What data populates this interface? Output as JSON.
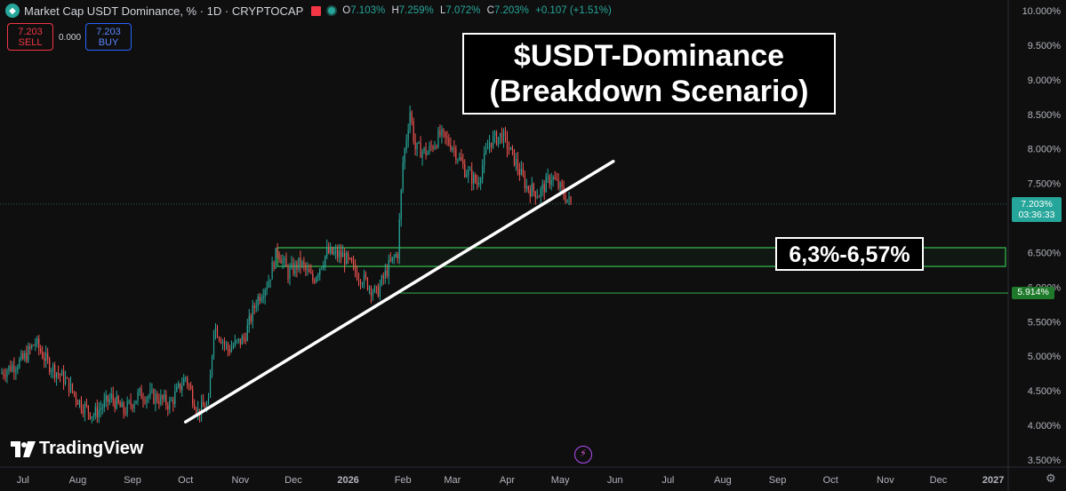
{
  "header": {
    "title": "Market Cap USDT Dominance, % · 1D · CRYPTOCAP",
    "ohlc": [
      {
        "k": "O",
        "v": "7.103%"
      },
      {
        "k": "H",
        "v": "7.259%"
      },
      {
        "k": "L",
        "v": "7.072%"
      },
      {
        "k": "C",
        "v": "7.203%"
      }
    ],
    "change": "+0.107 (+1.51%)"
  },
  "trade": {
    "sell_price": "7.203",
    "sell_label": "SELL",
    "spread": "0.000",
    "buy_price": "7.203",
    "buy_label": "BUY"
  },
  "annotations": {
    "title_line1": "$USDT-Dominance",
    "title_line2": "(Breakdown Scenario)",
    "zone_label": "6,3%-6,57%"
  },
  "price_scale": {
    "current_price": "7.203%",
    "countdown": "03:36:33",
    "level_tag": "5.914%"
  },
  "brand": {
    "logo_text": "TradingView"
  },
  "colors": {
    "up": "#26a69a",
    "down": "#ef5350",
    "zone": "#2f9e44",
    "trendline": "#ffffff"
  },
  "chart_data": {
    "type": "candlestick",
    "y_ticks": [
      "10.000%",
      "9.500%",
      "9.000%",
      "8.500%",
      "8.000%",
      "7.500%",
      "7.000%",
      "6.500%",
      "6.000%",
      "5.500%",
      "5.000%",
      "4.500%",
      "4.000%",
      "3.500%"
    ],
    "y_tick_values": [
      10.0,
      9.5,
      9.0,
      8.5,
      8.0,
      7.5,
      7.0,
      6.5,
      6.0,
      5.5,
      5.0,
      4.5,
      4.0,
      3.5
    ],
    "ylim": [
      3.5,
      10.0
    ],
    "x_ticks": [
      "Jul",
      "Aug",
      "Sep",
      "Oct",
      "Nov",
      "Dec",
      "2026",
      "Feb",
      "Mar",
      "Apr",
      "May",
      "Jun",
      "Jul",
      "Aug",
      "Sep",
      "Oct",
      "Nov",
      "Dec",
      "2027"
    ],
    "x_tick_dates": [
      "2025-07-01",
      "2025-08-01",
      "2025-09-01",
      "2025-10-01",
      "2025-11-01",
      "2025-12-01",
      "2026-01-01",
      "2026-02-01",
      "2026-03-01",
      "2026-04-01",
      "2026-05-01",
      "2026-06-01",
      "2026-07-01",
      "2026-08-01",
      "2026-09-01",
      "2026-10-01",
      "2026-11-01",
      "2026-12-01",
      "2027-01-01"
    ],
    "x_range": [
      "2025-06-18",
      "2027-01-08"
    ],
    "price_path": [
      [
        "2025-06-18",
        4.75
      ],
      [
        "2025-07-01",
        4.95
      ],
      [
        "2025-07-08",
        5.2
      ],
      [
        "2025-07-15",
        4.9
      ],
      [
        "2025-07-25",
        4.65
      ],
      [
        "2025-08-03",
        4.3
      ],
      [
        "2025-08-10",
        4.15
      ],
      [
        "2025-08-20",
        4.4
      ],
      [
        "2025-08-27",
        4.2
      ],
      [
        "2025-09-05",
        4.45
      ],
      [
        "2025-09-15",
        4.4
      ],
      [
        "2025-09-22",
        4.3
      ],
      [
        "2025-10-01",
        4.7
      ],
      [
        "2025-10-08",
        4.2
      ],
      [
        "2025-10-14",
        4.3
      ],
      [
        "2025-10-17",
        5.45
      ],
      [
        "2025-10-25",
        5.1
      ],
      [
        "2025-11-03",
        5.25
      ],
      [
        "2025-11-10",
        5.8
      ],
      [
        "2025-11-17",
        6.1
      ],
      [
        "2025-11-22",
        6.55
      ],
      [
        "2025-11-28",
        6.2
      ],
      [
        "2025-12-05",
        6.35
      ],
      [
        "2025-12-12",
        6.1
      ],
      [
        "2025-12-20",
        6.5
      ],
      [
        "2025-12-29",
        6.45
      ],
      [
        "2026-01-06",
        6.2
      ],
      [
        "2026-01-12",
        6.05
      ],
      [
        "2026-01-17",
        5.9
      ],
      [
        "2026-01-24",
        6.3
      ],
      [
        "2026-01-29",
        6.5
      ],
      [
        "2026-02-01",
        7.8
      ],
      [
        "2026-02-05",
        8.55
      ],
      [
        "2026-02-08",
        8.0
      ],
      [
        "2026-02-15",
        7.95
      ],
      [
        "2026-02-22",
        8.2
      ],
      [
        "2026-03-01",
        8.05
      ],
      [
        "2026-03-08",
        7.7
      ],
      [
        "2026-03-15",
        7.5
      ],
      [
        "2026-03-22",
        8.1
      ],
      [
        "2026-03-29",
        8.2
      ],
      [
        "2026-04-05",
        7.85
      ],
      [
        "2026-04-12",
        7.45
      ],
      [
        "2026-04-19",
        7.35
      ],
      [
        "2026-04-26",
        7.6
      ],
      [
        "2026-05-03",
        7.35
      ],
      [
        "2026-05-07",
        7.2
      ]
    ],
    "trendline": {
      "start": [
        "2025-10-01",
        4.05
      ],
      "end": [
        "2026-05-31",
        7.82
      ]
    },
    "zone": {
      "from": "2025-11-22",
      "to": "2027-01-08",
      "low": 6.3,
      "high": 6.57
    },
    "level": {
      "from": "2026-01-30",
      "value": 5.914
    },
    "current": {
      "value": 7.203
    }
  }
}
